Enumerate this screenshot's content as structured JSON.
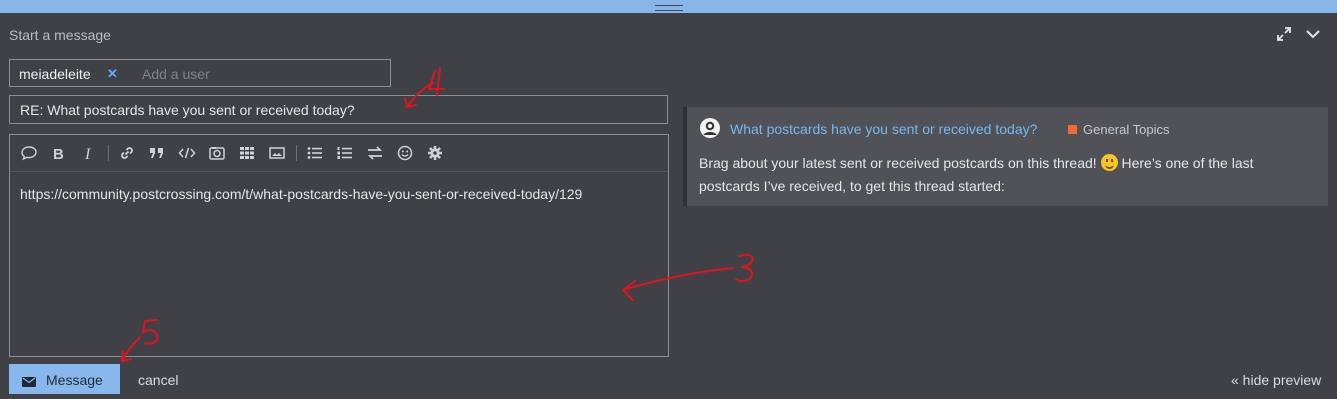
{
  "composer": {
    "title": "Start a message",
    "recipient": "meiadeleite",
    "add_user_placeholder": "Add a user",
    "subject": "RE: What postcards have you sent or received today?",
    "body": "https://community.postcrossing.com/t/what-postcards-have-you-sent-or-received-today/129",
    "toolbar_icons": [
      "quote-icon",
      "bold-icon",
      "italic-icon",
      "link-icon",
      "blockquote-icon",
      "code-icon",
      "upload-image-icon",
      "table-icon",
      "image-icon",
      "bullet-list-icon",
      "numbered-list-icon",
      "toggle-direction-icon",
      "emoji-icon",
      "options-gear-icon"
    ],
    "send_label": "Message",
    "cancel_label": "cancel",
    "hide_preview_label": "« hide preview"
  },
  "preview": {
    "topic_title": "What postcards have you sent or received today?",
    "category": "General Topics",
    "category_color": "#f26b36",
    "excerpt_before": "Brag about your latest sent or received postcards on this thread!",
    "excerpt_after": "Here’s one of the last postcards I’ve received, to get this thread started:"
  },
  "annotations": {
    "color": "#e0141e",
    "labels": [
      "4",
      "3",
      "5"
    ]
  },
  "colors": {
    "accent": "#88b7ec",
    "background": "#3f4146",
    "link": "#76b8ef"
  }
}
